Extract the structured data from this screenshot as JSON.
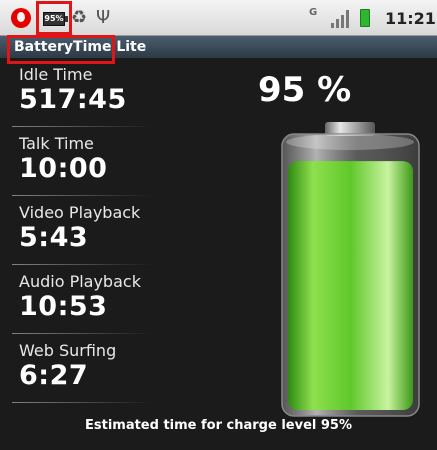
{
  "status_bar": {
    "battery_notification": "95%",
    "network_label": "G",
    "time": "11:21",
    "icons": [
      "vodafone-icon",
      "battery-notification-icon",
      "recycle-icon",
      "usb-icon",
      "signal-icon",
      "charging-battery-icon"
    ]
  },
  "app": {
    "title": "BatteryTime Lite"
  },
  "stats": [
    {
      "label": "Idle Time",
      "value": "517:45"
    },
    {
      "label": "Talk Time",
      "value": "10:00"
    },
    {
      "label": "Video Playback",
      "value": "5:43"
    },
    {
      "label": "Audio Playback",
      "value": "10:53"
    },
    {
      "label": "Web Surfing",
      "value": "6:27"
    }
  ],
  "battery": {
    "percent_text": "95 %",
    "level": 0.95,
    "fill_color": "#5fc82a"
  },
  "footer": {
    "text": "Estimated time for charge level 95%"
  }
}
